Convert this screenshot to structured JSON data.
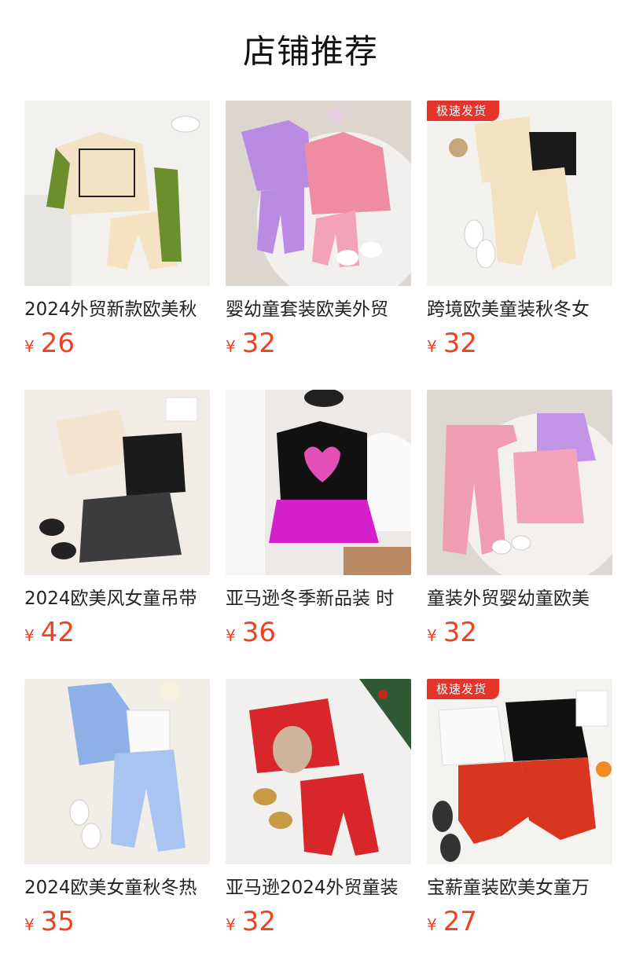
{
  "page": {
    "title": "店铺推荐"
  },
  "colors": {
    "price": "#f0421f",
    "badge": "#e5352b"
  },
  "products": [
    {
      "name": "2024外贸新款欧美秋",
      "currency": "¥",
      "price": "26",
      "badge": ""
    },
    {
      "name": "婴幼童套装欧美外贸",
      "currency": "¥",
      "price": "32",
      "badge": ""
    },
    {
      "name": "跨境欧美童装秋冬女",
      "currency": "¥",
      "price": "32",
      "badge": "极速发货"
    },
    {
      "name": "2024欧美风女童吊带",
      "currency": "¥",
      "price": "42",
      "badge": ""
    },
    {
      "name": "亚马逊冬季新品装 时",
      "currency": "¥",
      "price": "36",
      "badge": ""
    },
    {
      "name": "童装外贸婴幼童欧美",
      "currency": "¥",
      "price": "32",
      "badge": ""
    },
    {
      "name": "2024欧美女童秋冬热",
      "currency": "¥",
      "price": "35",
      "badge": ""
    },
    {
      "name": "亚马逊2024外贸童装",
      "currency": "¥",
      "price": "32",
      "badge": ""
    },
    {
      "name": "宝薪童装欧美女童万",
      "currency": "¥",
      "price": "27",
      "badge": "极速发货"
    }
  ]
}
